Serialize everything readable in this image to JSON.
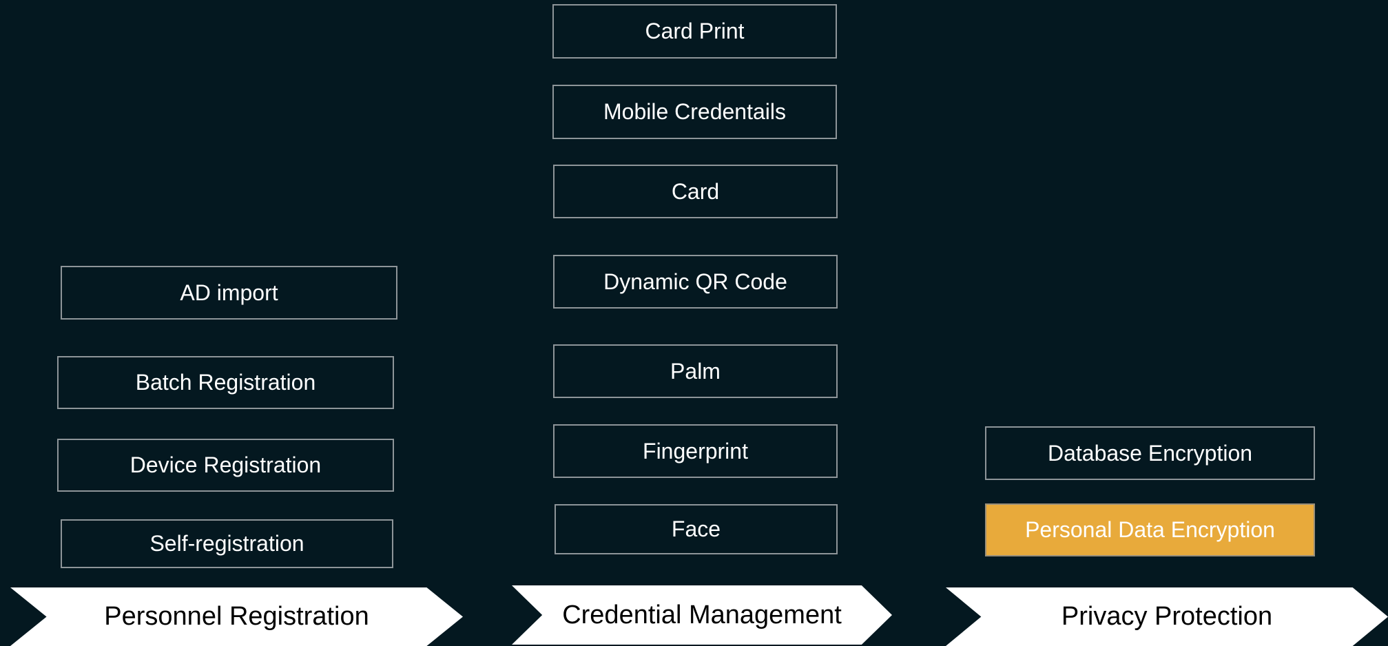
{
  "columns": [
    {
      "header": "Personnel Registration",
      "items": [
        "AD import",
        "Batch Registration",
        "Device Registration",
        "Self-registration"
      ]
    },
    {
      "header": "Credential Management",
      "items": [
        "Card Print",
        "Mobile Credentails",
        "Card",
        "Dynamic QR Code",
        "Palm",
        "Fingerprint",
        "Face"
      ]
    },
    {
      "header": "Privacy Protection",
      "items": [
        "Database Encryption",
        "Personal Data Encryption"
      ],
      "highlighted_item": "Personal Data Encryption",
      "highlight_color": "#E8AA3B"
    }
  ],
  "colors": {
    "background": "#041820",
    "box_border": "#8E9599",
    "box_text": "#FFFFFF",
    "chevron_fill": "#FFFFFF",
    "chevron_text": "#000000"
  }
}
